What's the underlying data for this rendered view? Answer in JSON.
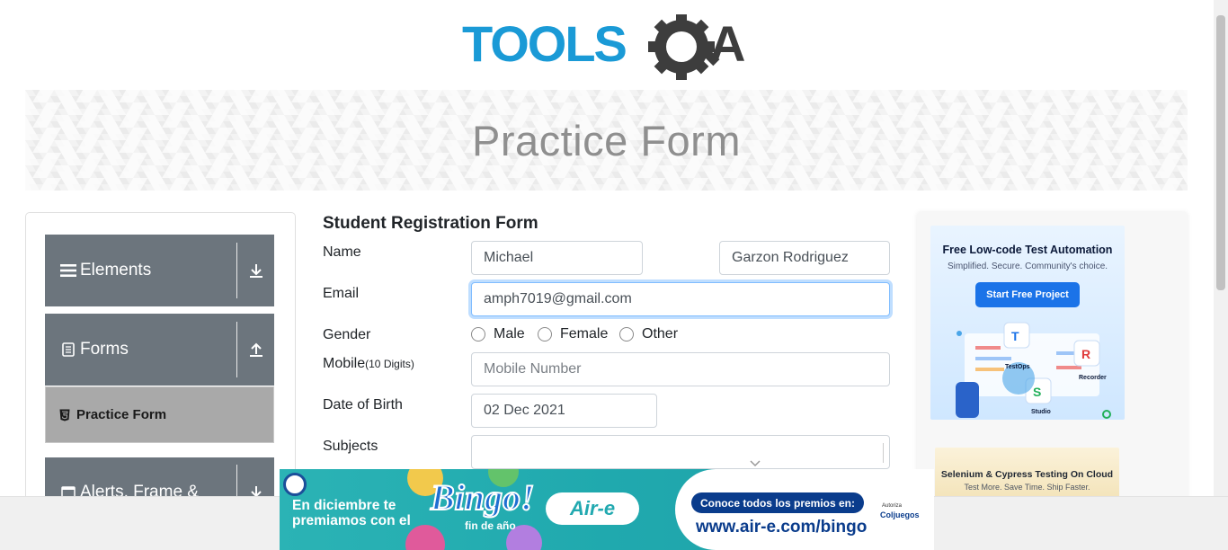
{
  "logo": {
    "text": "TOOLSQA"
  },
  "banner": {
    "title": "Practice Form"
  },
  "sidebar": {
    "groups": [
      {
        "label": "Elements",
        "icon": "hamburger-icon",
        "arrow": "download-arrow-icon"
      },
      {
        "label": "Forms",
        "icon": "document-icon",
        "arrow": "upload-arrow-icon"
      },
      {
        "label": "Alerts, Frame &",
        "icon": "window-icon",
        "arrow": "download-arrow-icon"
      }
    ],
    "active_item": {
      "label": "Practice Form",
      "icon": "html5-icon"
    }
  },
  "form": {
    "title": "Student Registration Form",
    "name_label": "Name",
    "first_name": "Michael",
    "last_name": "Garzon Rodriguez",
    "email_label": "Email",
    "email": "amph7019@gmail.com",
    "gender_label": "Gender",
    "genders": [
      "Male",
      "Female",
      "Other"
    ],
    "mobile_label": "Mobile",
    "mobile_hint": "(10 Digits)",
    "mobile_placeholder": "Mobile Number",
    "dob_label": "Date of Birth",
    "dob": "02 Dec 2021",
    "subjects_label": "Subjects"
  },
  "ads": {
    "right_top": {
      "title": "Free Low-code Test Automation",
      "subtitle": "Simplified. Secure. Community's choice.",
      "button": "Start Free Project",
      "tags": [
        "TestOps",
        "Recorder",
        "Studio"
      ]
    },
    "right_bottom": {
      "title": "Selenium & Cypress Testing On Cloud",
      "subtitle": "Test More. Save Time. Ship Faster."
    },
    "bottom": {
      "headline": "En diciembre te premiamos con el",
      "brand_word": "Bingo!",
      "brand_sub": "fin de año",
      "company": "Air-e",
      "cta": "Conoce todos los premios en:",
      "url": "www.air-e.com/bingo",
      "auth": "Autoriza",
      "regulator": "Coljuegos"
    }
  },
  "colors": {
    "logo_blue": "#1a9ad6",
    "logo_dark": "#3d3d3d",
    "sidebar_group": "#6c757d",
    "sidebar_active": "#a9a9a9",
    "focus_border": "#80bdff"
  }
}
